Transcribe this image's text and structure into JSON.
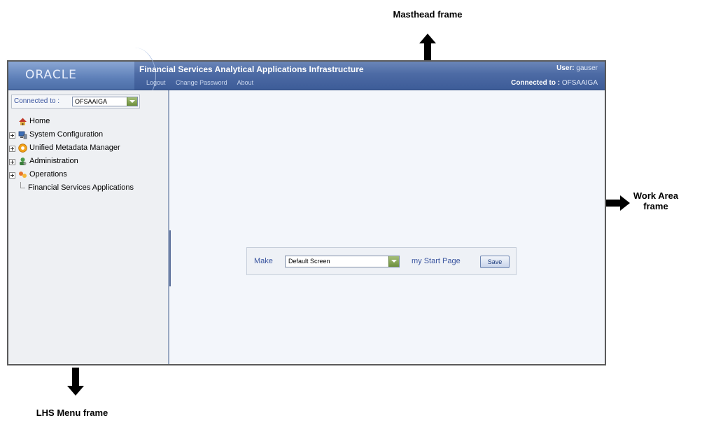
{
  "callouts": {
    "masthead": "Masthead frame",
    "work_area_line1": "Work Area",
    "work_area_line2": "frame",
    "lhs": "LHS Menu frame"
  },
  "masthead": {
    "logo": "ORACLE",
    "title": "Financial Services Analytical Applications Infrastructure",
    "user_label": "User:",
    "user_value": "gauser",
    "links": [
      "Logout",
      "Change Password",
      "About"
    ],
    "connected_label": "Connected to :",
    "connected_value": "OFSAAIGA"
  },
  "lhs": {
    "connected_label": "Connected to :",
    "connected_value": "OFSAAIGA",
    "tree": [
      {
        "label": "Home",
        "icon": "home-icon"
      },
      {
        "label": "System Configuration",
        "icon": "system-configuration-icon",
        "expandable": true
      },
      {
        "label": "Unified Metadata Manager",
        "icon": "metadata-manager-icon",
        "expandable": true
      },
      {
        "label": "Administration",
        "icon": "administration-icon",
        "expandable": true
      },
      {
        "label": "Operations",
        "icon": "operations-icon",
        "expandable": true
      },
      {
        "label": "Financial Services Applications",
        "icon": "",
        "leaf": true
      }
    ]
  },
  "work": {
    "make_label": "Make",
    "screen_value": "Default Screen",
    "start_page_label": "my Start Page",
    "save_label": "Save"
  },
  "colors": {
    "masthead": "#4c6aa4",
    "link_text": "#3b56a0",
    "lhs_bg": "#eef0f3",
    "work_bg": "#f3f6fb",
    "dropdown_button": "#6d8f3c"
  }
}
